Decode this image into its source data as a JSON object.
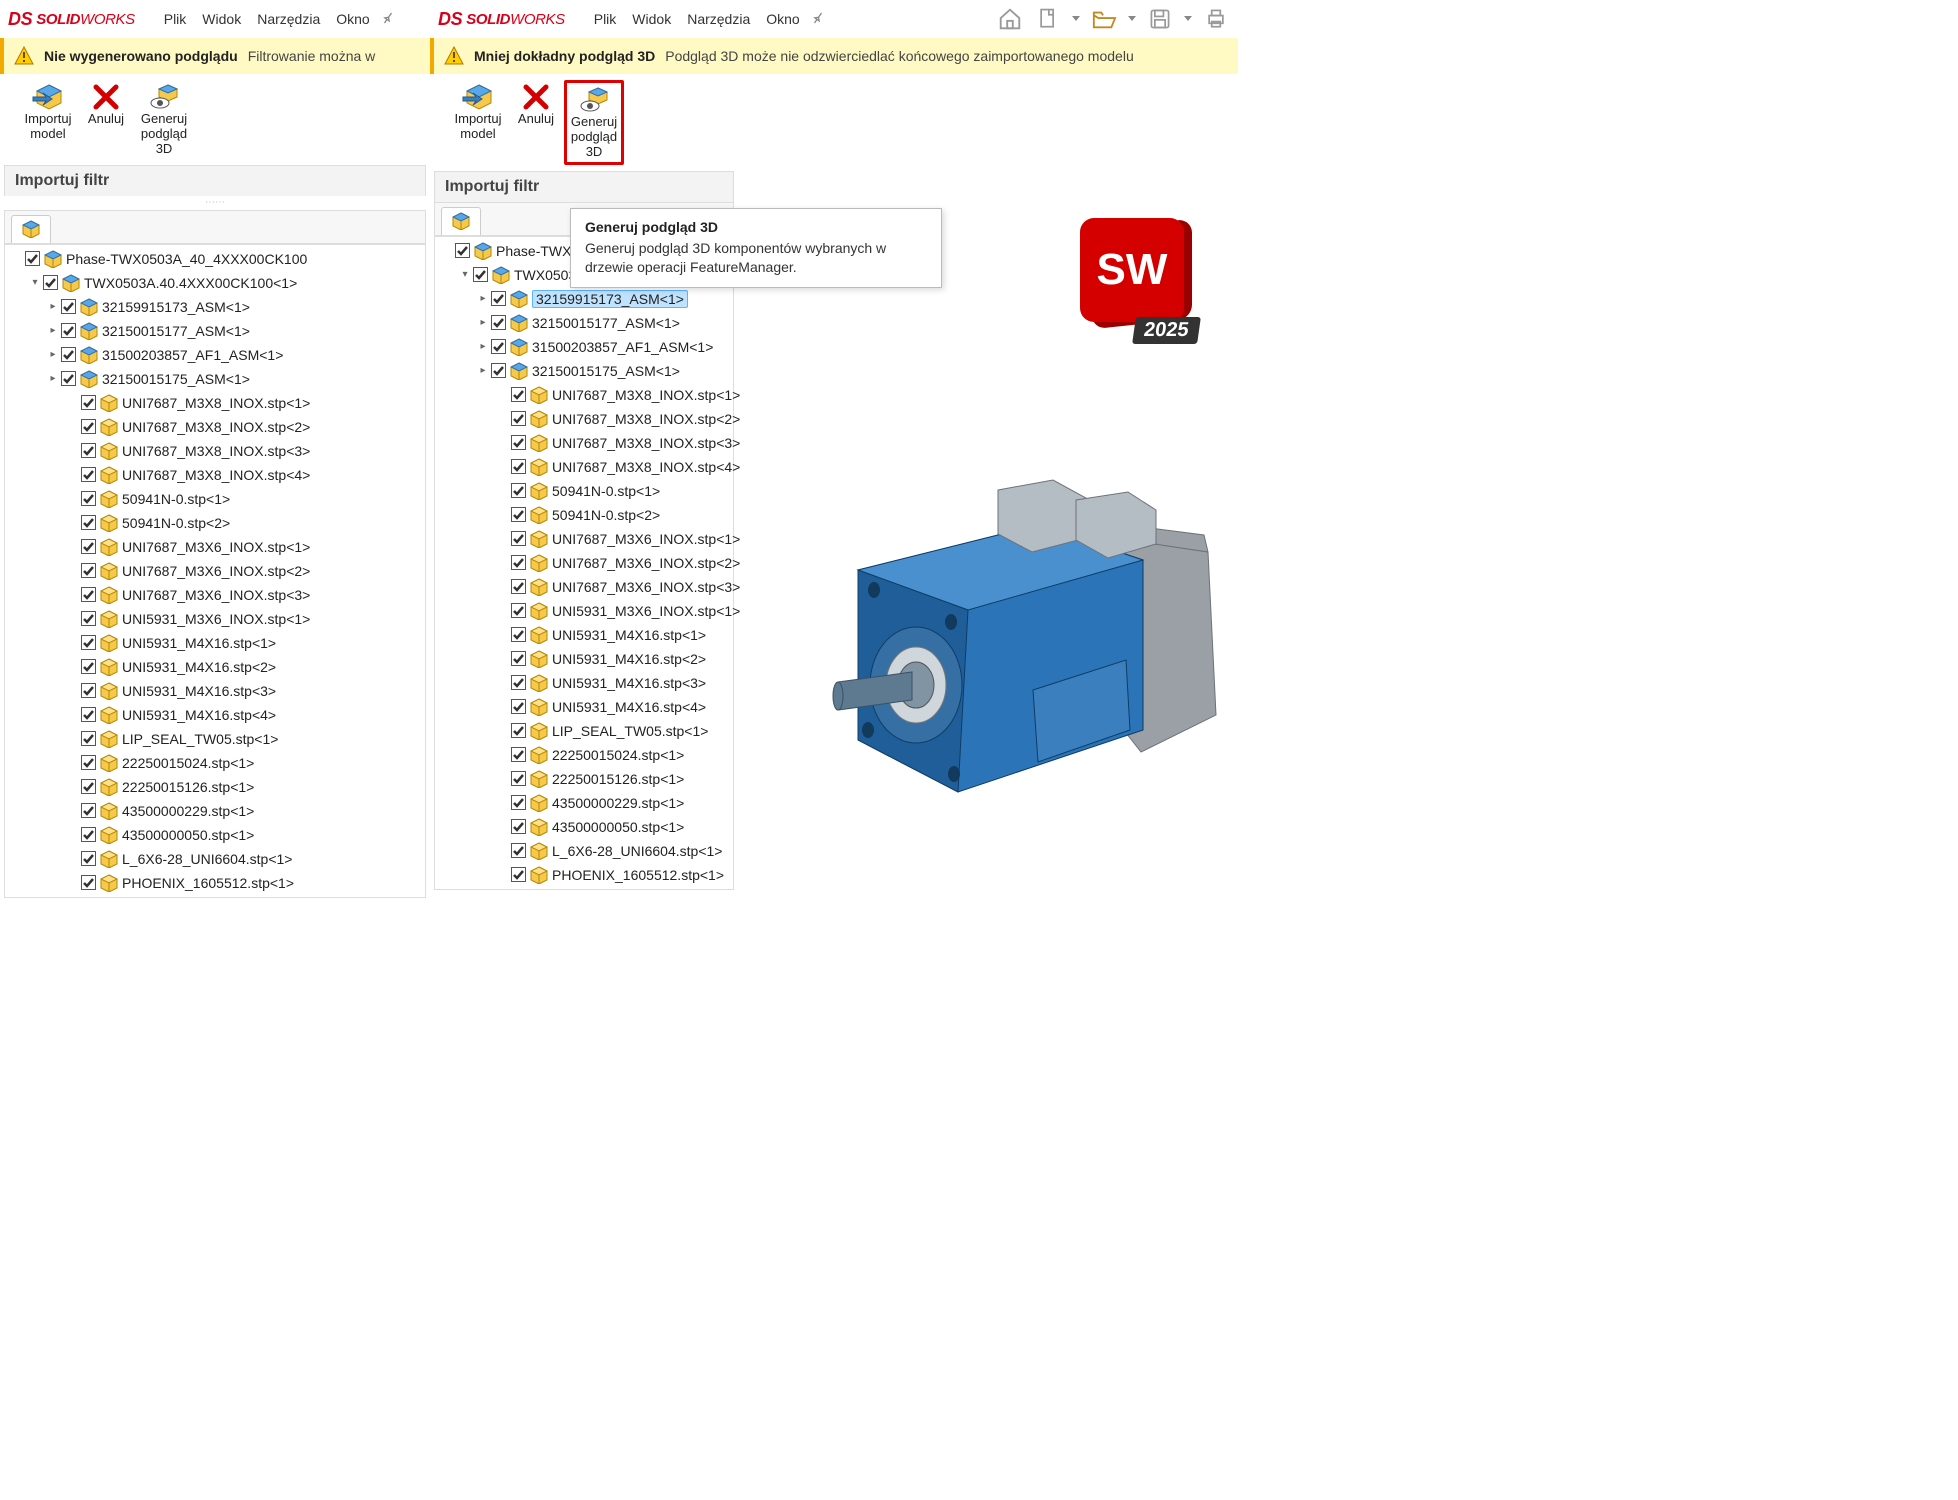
{
  "app": {
    "logo_ds": "DS",
    "logo_solid": "SOLID",
    "logo_works": "WORKS"
  },
  "menu": [
    "Plik",
    "Widok",
    "Narzędzia",
    "Okno"
  ],
  "left": {
    "warn_title": "Nie wygenerowano podglądu",
    "warn_msg": "Filtrowanie można w"
  },
  "right": {
    "warn_title": "Mniej dokładny podgląd 3D",
    "warn_msg": "Podgląd 3D może nie odzwierciedlać końcowego zaimportowanego modelu"
  },
  "toolbar": {
    "import_l1": "Importuj",
    "import_l2": "model",
    "cancel": "Anuluj",
    "gen_l1": "Generuj",
    "gen_l2": "podgląd",
    "gen_l3": "3D"
  },
  "filter_header": "Importuj filtr",
  "tooltip": {
    "title": "Generuj podgląd 3D",
    "body": "Generuj podgląd 3D komponentów wybranych w drzewie operacji FeatureManager."
  },
  "tree": {
    "root": "Phase-TWX0503A_40_4XXX00CK100",
    "asm": "TWX0503A.40.4XXX00CK100<1>",
    "sub": [
      "32159915173_ASM<1>",
      "32150015177_ASM<1>",
      "31500203857_AF1_ASM<1>",
      "32150015175_ASM<1>"
    ],
    "parts": [
      "UNI7687_M3X8_INOX.stp<1>",
      "UNI7687_M3X8_INOX.stp<2>",
      "UNI7687_M3X8_INOX.stp<3>",
      "UNI7687_M3X8_INOX.stp<4>",
      "50941N-0.stp<1>",
      "50941N-0.stp<2>",
      "UNI7687_M3X6_INOX.stp<1>",
      "UNI7687_M3X6_INOX.stp<2>",
      "UNI7687_M3X6_INOX.stp<3>",
      "UNI5931_M3X6_INOX.stp<1>",
      "UNI5931_M4X16.stp<1>",
      "UNI5931_M4X16.stp<2>",
      "UNI5931_M4X16.stp<3>",
      "UNI5931_M4X16.stp<4>",
      "LIP_SEAL_TW05.stp<1>",
      "22250015024.stp<1>",
      "22250015126.stp<1>",
      "43500000229.stp<1>",
      "43500000050.stp<1>",
      "L_6X6-28_UNI6604.stp<1>",
      "PHOENIX_1605512.stp<1>"
    ]
  },
  "badge": {
    "letters": "SW",
    "year": "2025"
  }
}
